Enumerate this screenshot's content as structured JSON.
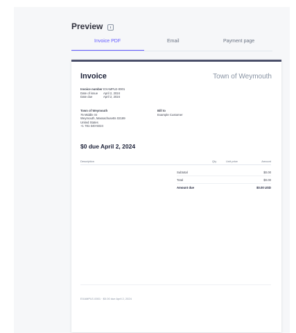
{
  "preview": {
    "title": "Preview",
    "tabs": [
      {
        "label": "Invoice PDF",
        "active": true
      },
      {
        "label": "Email",
        "active": false
      },
      {
        "label": "Payment page",
        "active": false
      }
    ]
  },
  "invoice": {
    "title": "Invoice",
    "company": "Town of Weymouth",
    "meta": [
      {
        "key": "Invoice number",
        "value": "EXAMPLE-0001"
      },
      {
        "key": "Date of issue",
        "value": "April 2, 2024"
      },
      {
        "key": "Date due",
        "value": "April 2, 2024"
      }
    ],
    "from": {
      "name": "Town of Weymouth",
      "lines": [
        "75 Middle St",
        "Weymouth, Massachusetts 02189",
        "United States",
        "+1 781-340-5024"
      ]
    },
    "bill_to": {
      "label": "Bill to",
      "name": "Example Customer"
    },
    "due_heading": "$0 due April 2, 2024",
    "table_headers": {
      "description": "Description",
      "qty": "Qty",
      "unit_price": "Unit price",
      "amount": "Amount"
    },
    "totals": [
      {
        "label": "Subtotal",
        "value": "$0.00"
      },
      {
        "label": "Total",
        "value": "$0.00"
      },
      {
        "label": "Amount due",
        "value": "$0.00 USD",
        "bold": true
      }
    ],
    "footer": "EXAMPLE-0001 · $0.00 due April 2, 2024"
  }
}
